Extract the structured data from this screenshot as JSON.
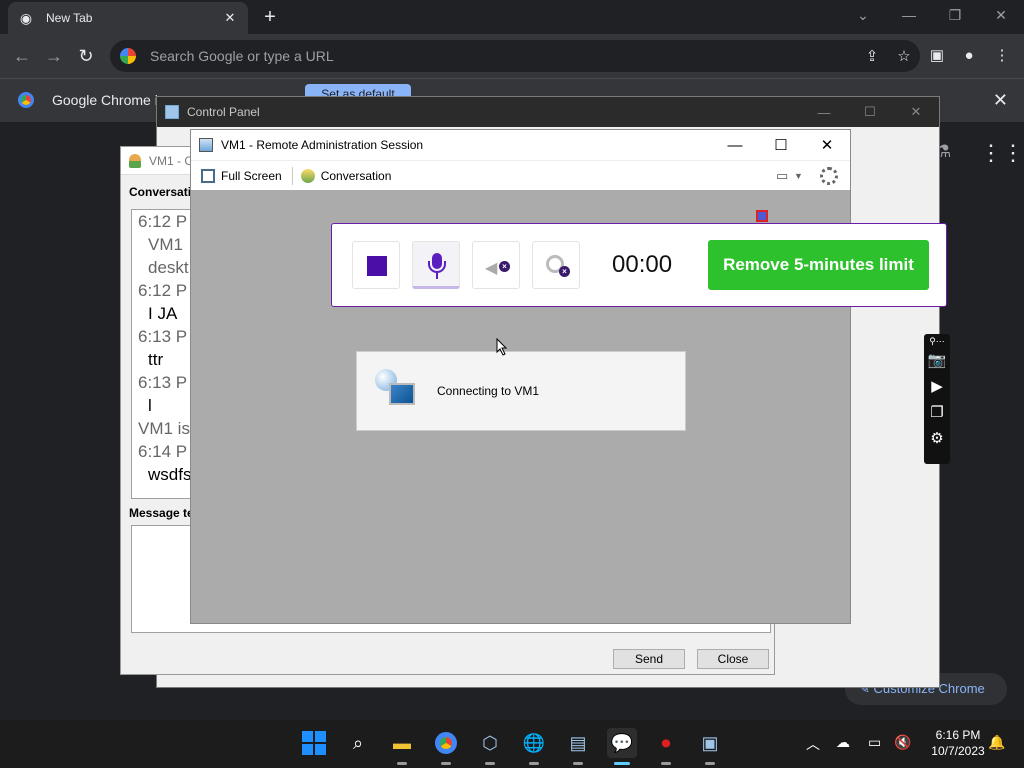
{
  "chrome": {
    "tab_title": "New Tab",
    "omnibox_placeholder": "Search Google or type a URL",
    "infobar_text": "Google Chrome is",
    "infobar_button": "Set as default",
    "customize_label": "Customize Chrome"
  },
  "control_panel": {
    "title": "Control Panel"
  },
  "chat": {
    "title": "VM1 - C",
    "conversation_label": "Conversatio",
    "message_label": "Message te",
    "send_label": "Send",
    "close_label": "Close",
    "log": [
      {
        "text": "6:12 P",
        "kind": "time"
      },
      {
        "text": "VM1",
        "kind": "sys"
      },
      {
        "text": "deskt",
        "kind": "sys"
      },
      {
        "text": "6:12 P",
        "kind": "time"
      },
      {
        "text": "I JA",
        "kind": "msg"
      },
      {
        "text": "6:13 P",
        "kind": "time"
      },
      {
        "text": "ttr",
        "kind": "msg"
      },
      {
        "text": "6:13 P",
        "kind": "time"
      },
      {
        "text": "l",
        "kind": "msg"
      },
      {
        "text": "VM1 is",
        "kind": "time"
      },
      {
        "text": "6:14 P",
        "kind": "time"
      },
      {
        "text": "wsdfs",
        "kind": "msg"
      }
    ]
  },
  "rdp": {
    "title": "VM1 - Remote Administration Session",
    "full_screen_label": "Full Screen",
    "conversation_label": "Conversation",
    "connecting_text": "Connecting to VM1"
  },
  "recorder": {
    "timer": "00:00",
    "limit_button": "Remove 5-minutes limit",
    "accent_color": "#5b1fbf",
    "limit_color": "#2dc12d"
  },
  "taskbar": {
    "time": "6:16 PM",
    "date": "10/7/2023",
    "apps": [
      "start",
      "search",
      "file-explorer",
      "chrome",
      "virtualbox",
      "network-globe",
      "hyperv",
      "chat",
      "recorder",
      "remote-admin"
    ]
  }
}
